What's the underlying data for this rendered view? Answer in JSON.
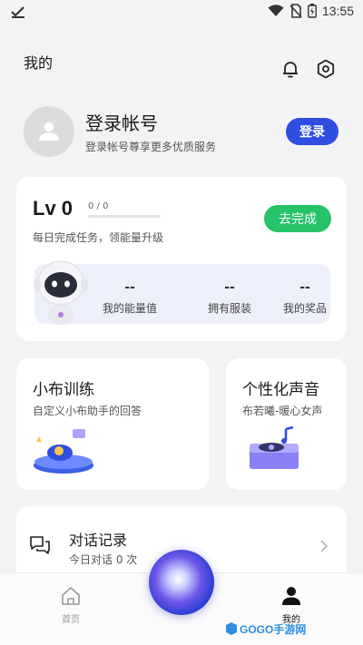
{
  "status_bar": {
    "time": "13:55"
  },
  "header": {
    "title": "我的"
  },
  "account": {
    "login_title": "登录帐号",
    "login_subtitle": "登录帐号尊享更多优质服务",
    "login_button": "登录"
  },
  "level": {
    "title": "Lv 0",
    "progress_text": "0 / 0",
    "progress_fraction": 0,
    "description": "每日完成任务，领能量升级",
    "complete_button": "去完成",
    "stats": [
      {
        "value": "--",
        "label": "我的能量值"
      },
      {
        "value": "--",
        "label": "拥有服装"
      },
      {
        "value": "--",
        "label": "我的奖品"
      }
    ]
  },
  "features": [
    {
      "title": "小布训练",
      "subtitle": "自定义小布助手的回答"
    },
    {
      "title": "个性化声音",
      "subtitle": "布若曦-暖心女声"
    }
  ],
  "history": {
    "title": "对话记录",
    "subtitle": "今日对话 0 次"
  },
  "bottom_nav": {
    "home_label": "首页",
    "mine_label": "我的"
  },
  "watermark": {
    "text": "GOGO手游网"
  },
  "colors": {
    "accent": "#2f4ee0",
    "success": "#27c36a",
    "panel": "#edeffb"
  },
  "icons": [
    "bell-icon",
    "settings-icon",
    "chat-icon",
    "chevron-right-icon",
    "home-icon",
    "person-icon"
  ]
}
